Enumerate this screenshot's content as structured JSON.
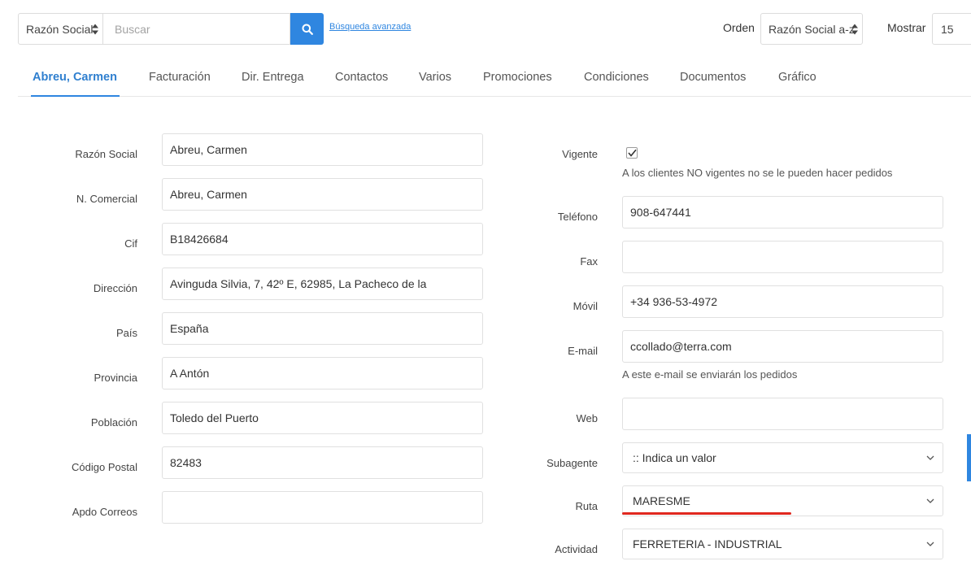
{
  "toolbar": {
    "field_select": "Razón Social",
    "search_placeholder": "Buscar",
    "advanced_search": "Búsqueda avanzada",
    "order_label": "Orden",
    "order_value": "Razón Social a-z",
    "show_label": "Mostrar",
    "show_value": "15"
  },
  "tabs": [
    {
      "label": "Abreu, Carmen",
      "active": true
    },
    {
      "label": "Facturación"
    },
    {
      "label": "Dir. Entrega"
    },
    {
      "label": "Contactos"
    },
    {
      "label": "Varios"
    },
    {
      "label": "Promociones"
    },
    {
      "label": "Condiciones"
    },
    {
      "label": "Documentos"
    },
    {
      "label": "Gráfico"
    }
  ],
  "left": {
    "razon_social": {
      "label": "Razón Social",
      "value": "Abreu, Carmen"
    },
    "nombre_comercial": {
      "label": "N. Comercial",
      "value": "Abreu, Carmen"
    },
    "cif": {
      "label": "Cif",
      "value": "B18426684"
    },
    "direccion": {
      "label": "Dirección",
      "value": "Avinguda Silvia, 7, 42º E, 62985, La Pacheco de la"
    },
    "pais": {
      "label": "País",
      "value": "España"
    },
    "provincia": {
      "label": "Provincia",
      "value": "A Antón"
    },
    "poblacion": {
      "label": "Población",
      "value": "Toledo del Puerto"
    },
    "codigo_postal": {
      "label": "Código Postal",
      "value": "82483"
    },
    "apdo_correos": {
      "label": "Apdo Correos",
      "value": ""
    }
  },
  "right": {
    "vigente": {
      "label": "Vigente",
      "checked": true,
      "hint": "A los clientes NO vigentes no se le pueden hacer pedidos"
    },
    "telefono": {
      "label": "Teléfono",
      "value": "908-647441"
    },
    "fax": {
      "label": "Fax",
      "value": ""
    },
    "movil": {
      "label": "Móvil",
      "value": "+34 936-53-4972"
    },
    "email": {
      "label": "E-mail",
      "value": "ccollado@terra.com",
      "hint": "A este e-mail se enviarán los pedidos"
    },
    "web": {
      "label": "Web",
      "value": ""
    },
    "subagente": {
      "label": "Subagente",
      "value": ":: Indica un valor"
    },
    "ruta": {
      "label": "Ruta",
      "value": "MARESME"
    },
    "actividad": {
      "label": "Actividad",
      "value": "FERRETERIA - INDUSTRIAL"
    }
  },
  "colors": {
    "accent": "#2f86e0",
    "active_tab": "#2f7fcf",
    "highlight_underline": "#e0281f"
  },
  "icons": [
    "sort-updown-icon",
    "search-icon",
    "chevron-down-icon",
    "checkmark-icon"
  ]
}
